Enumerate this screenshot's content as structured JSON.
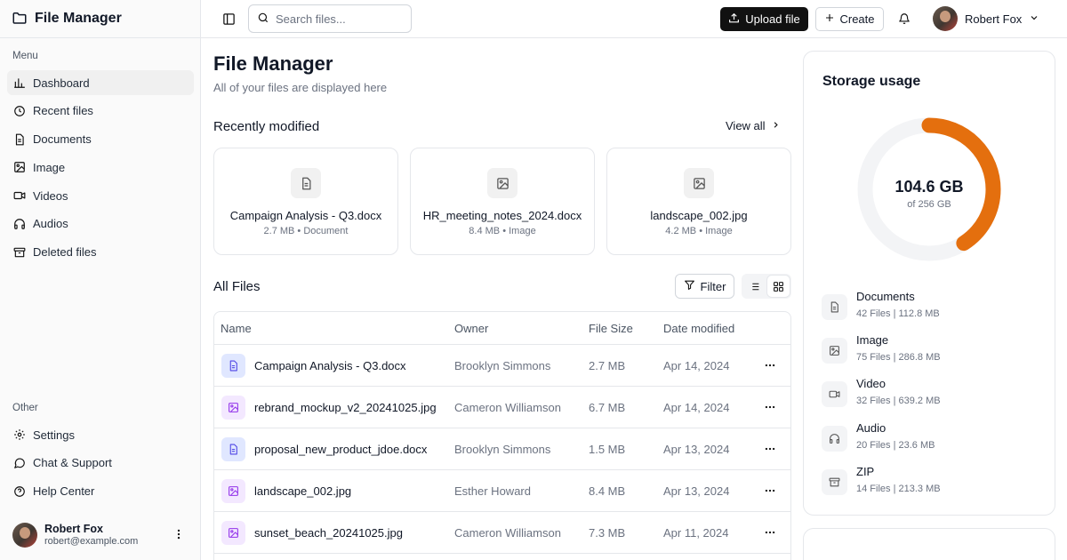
{
  "app": {
    "title": "File Manager"
  },
  "sidebar": {
    "menu_label": "Menu",
    "items": [
      {
        "label": "Dashboard",
        "icon": "chart-bar-icon",
        "active": true
      },
      {
        "label": "Recent files",
        "icon": "clock-icon"
      },
      {
        "label": "Documents",
        "icon": "document-icon"
      },
      {
        "label": "Image",
        "icon": "image-icon"
      },
      {
        "label": "Videos",
        "icon": "video-icon"
      },
      {
        "label": "Audios",
        "icon": "headphones-icon"
      },
      {
        "label": "Deleted files",
        "icon": "archive-icon"
      }
    ],
    "other_label": "Other",
    "other_items": [
      {
        "label": "Settings",
        "icon": "gear-icon"
      },
      {
        "label": "Chat & Support",
        "icon": "chat-icon"
      },
      {
        "label": "Help Center",
        "icon": "help-icon"
      }
    ],
    "user": {
      "name": "Robert Fox",
      "email": "robert@example.com"
    }
  },
  "topbar": {
    "search_placeholder": "Search files...",
    "upload_label": "Upload file",
    "create_label": "Create",
    "user_name": "Robert Fox"
  },
  "main": {
    "title": "File Manager",
    "subtitle": "All of your files are displayed here",
    "recent_title": "Recently modified",
    "view_all": "View all",
    "recent": [
      {
        "name": "Campaign Analysis - Q3.docx",
        "meta": "2.7 MB • Document",
        "icon": "document-icon"
      },
      {
        "name": "HR_meeting_notes_2024.docx",
        "meta": "8.4 MB • Image",
        "icon": "image-icon"
      },
      {
        "name": "landscape_002.jpg",
        "meta": "4.2 MB • Image",
        "icon": "image-icon"
      }
    ],
    "all_title": "All Files",
    "filter_label": "Filter",
    "columns": {
      "name": "Name",
      "owner": "Owner",
      "size": "File Size",
      "date": "Date modified"
    },
    "files": [
      {
        "name": "Campaign Analysis - Q3.docx",
        "owner": "Brooklyn Simmons",
        "size": "2.7 MB",
        "date": "Apr 14, 2024",
        "type": "doc"
      },
      {
        "name": "rebrand_mockup_v2_20241025.jpg",
        "owner": "Cameron Williamson",
        "size": "6.7 MB",
        "date": "Apr 14, 2024",
        "type": "img"
      },
      {
        "name": "proposal_new_product_jdoe.docx",
        "owner": "Brooklyn Simmons",
        "size": "1.5 MB",
        "date": "Apr 13, 2024",
        "type": "doc"
      },
      {
        "name": "landscape_002.jpg",
        "owner": "Esther Howard",
        "size": "8.4 MB",
        "date": "Apr 13, 2024",
        "type": "img"
      },
      {
        "name": "sunset_beach_20241025.jpg",
        "owner": "Cameron Williamson",
        "size": "7.3 MB",
        "date": "Apr 11, 2024",
        "type": "img"
      }
    ]
  },
  "storage": {
    "title": "Storage usage",
    "used": "104.6 GB",
    "total": "of 256 GB",
    "used_fraction": 0.409,
    "accent": "#e46f0e",
    "track": "#f3f4f6",
    "categories": [
      {
        "name": "Documents",
        "meta": "42 Files | 112.8 MB",
        "icon": "document-icon"
      },
      {
        "name": "Image",
        "meta": "75 Files | 286.8 MB",
        "icon": "image-icon"
      },
      {
        "name": "Video",
        "meta": "32 Files | 639.2 MB",
        "icon": "video-icon"
      },
      {
        "name": "Audio",
        "meta": "20 Files | 23.6 MB",
        "icon": "headphones-icon"
      },
      {
        "name": "ZIP",
        "meta": "14 Files | 213.3 MB",
        "icon": "archive-icon"
      }
    ]
  }
}
